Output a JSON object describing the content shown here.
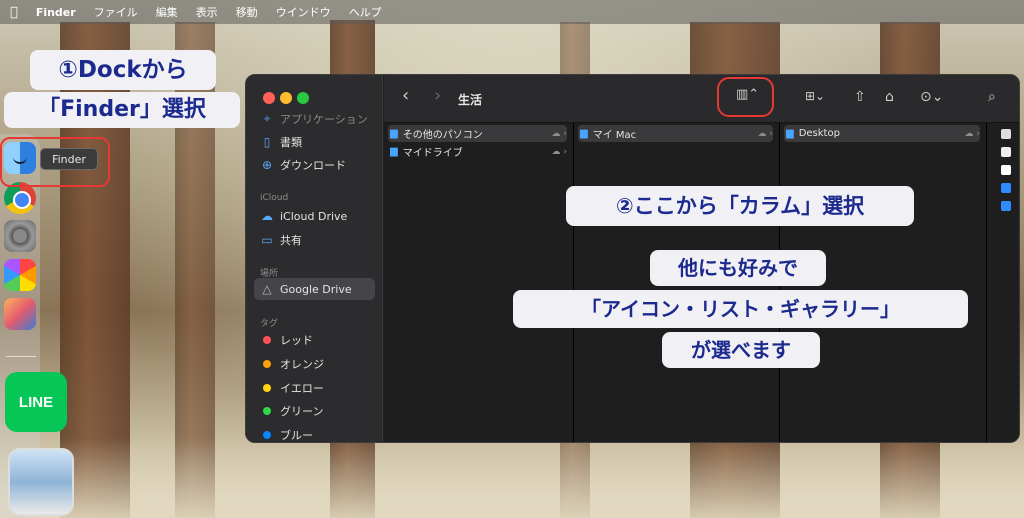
{
  "menubar": {
    "apple": "",
    "app_name": "Finder",
    "items": [
      "ファイル",
      "編集",
      "表示",
      "移動",
      "ウインドウ",
      "ヘルプ"
    ]
  },
  "dock": {
    "tooltip": "Finder",
    "line_label": "LINE",
    "icons": [
      "finder-icon",
      "chrome-icon",
      "system-settings-icon",
      "photos-icon",
      "iphone-mirroring-icon",
      "line-icon",
      "preview-icon"
    ]
  },
  "annotations": {
    "step1_line1": "①Dockから",
    "step1_line2": "「Finder」選択",
    "step2_line1": "②ここから「カラム」選択",
    "step2_line2": "他にも好みで",
    "step2_line3": "「アイコン・リスト・ギャラリー」",
    "step2_line4": "が選べます",
    "highlight_color": "#e53935",
    "text_color": "#1c2a8f"
  },
  "finder": {
    "title": "生活",
    "sidebar": {
      "cut_item": "アプリケーション",
      "favorites": [
        {
          "icon": "document-icon",
          "label": "書類"
        },
        {
          "icon": "download-icon",
          "label": "ダウンロード"
        }
      ],
      "icloud_header": "iCloud",
      "icloud": [
        {
          "icon": "cloud-icon",
          "label": "iCloud Drive"
        },
        {
          "icon": "shared-folder-icon",
          "label": "共有"
        }
      ],
      "locations_header": "場所",
      "locations": [
        {
          "icon": "drive-icon",
          "label": "Google Drive"
        }
      ],
      "tags_header": "タグ",
      "tags": [
        {
          "label": "レッド",
          "color": "#ff5257"
        },
        {
          "label": "オレンジ",
          "color": "#ff9f0a"
        },
        {
          "label": "イエロー",
          "color": "#ffd60a"
        },
        {
          "label": "グリーン",
          "color": "#32d74b"
        },
        {
          "label": "ブルー",
          "color": "#0a84ff"
        }
      ]
    },
    "toolbar": {
      "back": "‹",
      "forward": "›",
      "view_icon": "▥⌃",
      "grid_icon": "⊞⌄",
      "share_icon": "⇧",
      "tag_icon": "⌂",
      "more_icon": "⊙⌄",
      "search_icon": "⌕"
    },
    "columns": {
      "col1": [
        "その他のパソコン",
        "マイドライブ"
      ],
      "col2": [
        "マイ Mac"
      ],
      "col3": [
        "Desktop"
      ]
    }
  }
}
